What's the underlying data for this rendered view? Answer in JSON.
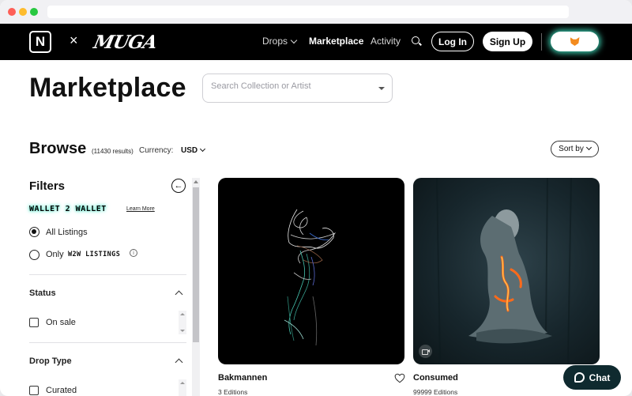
{
  "nav": {
    "logo_letter": "N",
    "times": "×",
    "brand": "MUGA",
    "drops": "Drops",
    "marketplace": "Marketplace",
    "activity": "Activity",
    "login": "Log In",
    "signup": "Sign Up",
    "wallet_icon": "metamask-fox-icon"
  },
  "page": {
    "title": "Marketplace",
    "search_placeholder": "Search Collection or Artist"
  },
  "browse": {
    "heading": "Browse",
    "results": "(11430 results)",
    "currency_label": "Currency:",
    "currency_value": "USD",
    "sort": "Sort by"
  },
  "filters": {
    "heading": "Filters",
    "badge": "WALLET 2 WALLET",
    "learn_more": "Learn More",
    "all_listings": "All Listings",
    "only": "Only",
    "w2w_listings": "W2W LISTINGS",
    "status_heading": "Status",
    "on_sale": "On sale",
    "drop_type_heading": "Drop Type",
    "curated": "Curated"
  },
  "cards": [
    {
      "title": "Bakmannen",
      "editions": "3 Editions"
    },
    {
      "title": "Consumed",
      "editions": "99999 Editions"
    }
  ],
  "chat": {
    "label": "Chat"
  },
  "colors": {
    "accent_glow": "#3fd6b6",
    "nav_bg": "#000000",
    "chat_bg": "#0f2a2f"
  }
}
